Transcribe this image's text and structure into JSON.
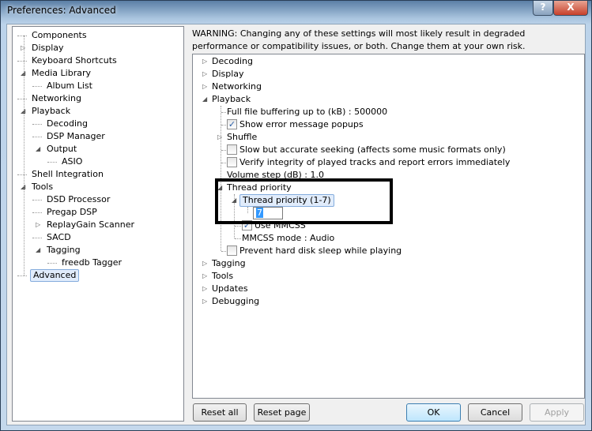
{
  "window": {
    "title": "Preferences: Advanced",
    "help": "?",
    "close": "X"
  },
  "left_tree": [
    "Components",
    "Display",
    "Keyboard Shortcuts",
    "Media Library",
    "Album List",
    "Networking",
    "Playback",
    "Decoding",
    "DSP Manager",
    "Output",
    "ASIO",
    "Shell Integration",
    "Tools",
    "DSD Processor",
    "Pregap DSP",
    "ReplayGain Scanner",
    "SACD",
    "Tagging",
    "freedb Tagger",
    "Advanced"
  ],
  "warning": "WARNING: Changing any of these settings will most likely result in degraded performance or compatibility issues, or both. Change them at your own risk.",
  "right_tree": {
    "decoding": "Decoding",
    "display": "Display",
    "networking": "Networking",
    "playback": "Playback",
    "buffering": "Full file buffering up to (kB) : 500000",
    "show_errors": {
      "label": "Show error message popups",
      "checked": true
    },
    "shuffle": "Shuffle",
    "slow_seek": {
      "label": "Slow but accurate seeking (affects some music formats only)",
      "checked": false
    },
    "verify": {
      "label": "Verify integrity of played tracks and report errors immediately",
      "checked": false
    },
    "volume_step": "Volume step (dB) : 1.0",
    "thread_priority": "Thread priority",
    "thread_priority_range": "Thread priority (1-7)",
    "thread_priority_value": "7",
    "use_mmcss": {
      "label": "Use MMCSS",
      "checked": true
    },
    "mmcss_mode": "MMCSS mode : Audio",
    "prevent_sleep": {
      "label": "Prevent hard disk sleep while playing",
      "checked": false
    },
    "tagging": "Tagging",
    "tools": "Tools",
    "updates": "Updates",
    "debugging": "Debugging"
  },
  "buttons": {
    "reset_all": "Reset all",
    "reset_page": "Reset page",
    "ok": "OK",
    "cancel": "Cancel",
    "apply": "Apply"
  }
}
